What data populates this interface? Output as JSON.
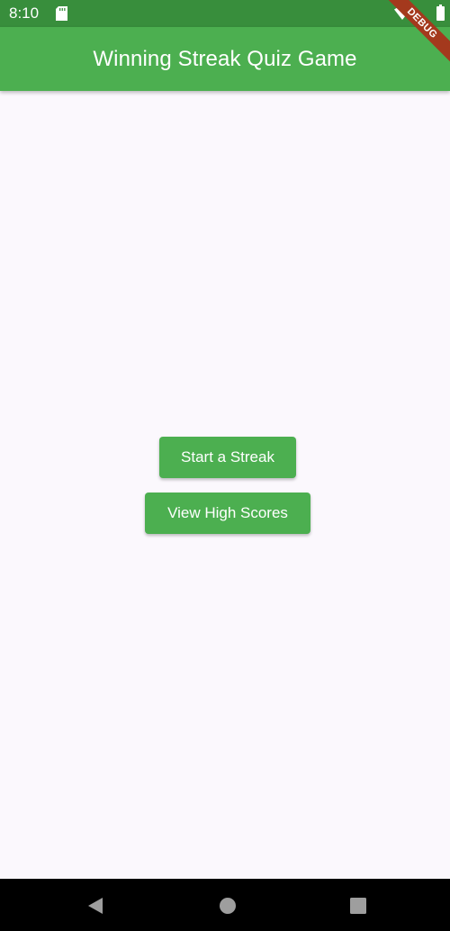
{
  "status_bar": {
    "time": "8:10",
    "icons": [
      "sd-card-icon",
      "wifi-icon",
      "battery-icon"
    ]
  },
  "app_bar": {
    "title": "Winning Streak Quiz Game"
  },
  "debug_banner": {
    "label": "DEBUG"
  },
  "main": {
    "start_button_label": "Start a Streak",
    "scores_button_label": "View High Scores"
  },
  "nav_bar": {
    "icons": [
      "back-icon",
      "home-icon",
      "recents-icon"
    ]
  },
  "colors": {
    "primary": "#4caf50",
    "status_bar": "#388e3c",
    "background": "#fbf8fd",
    "debug_banner": "#a4391d"
  }
}
